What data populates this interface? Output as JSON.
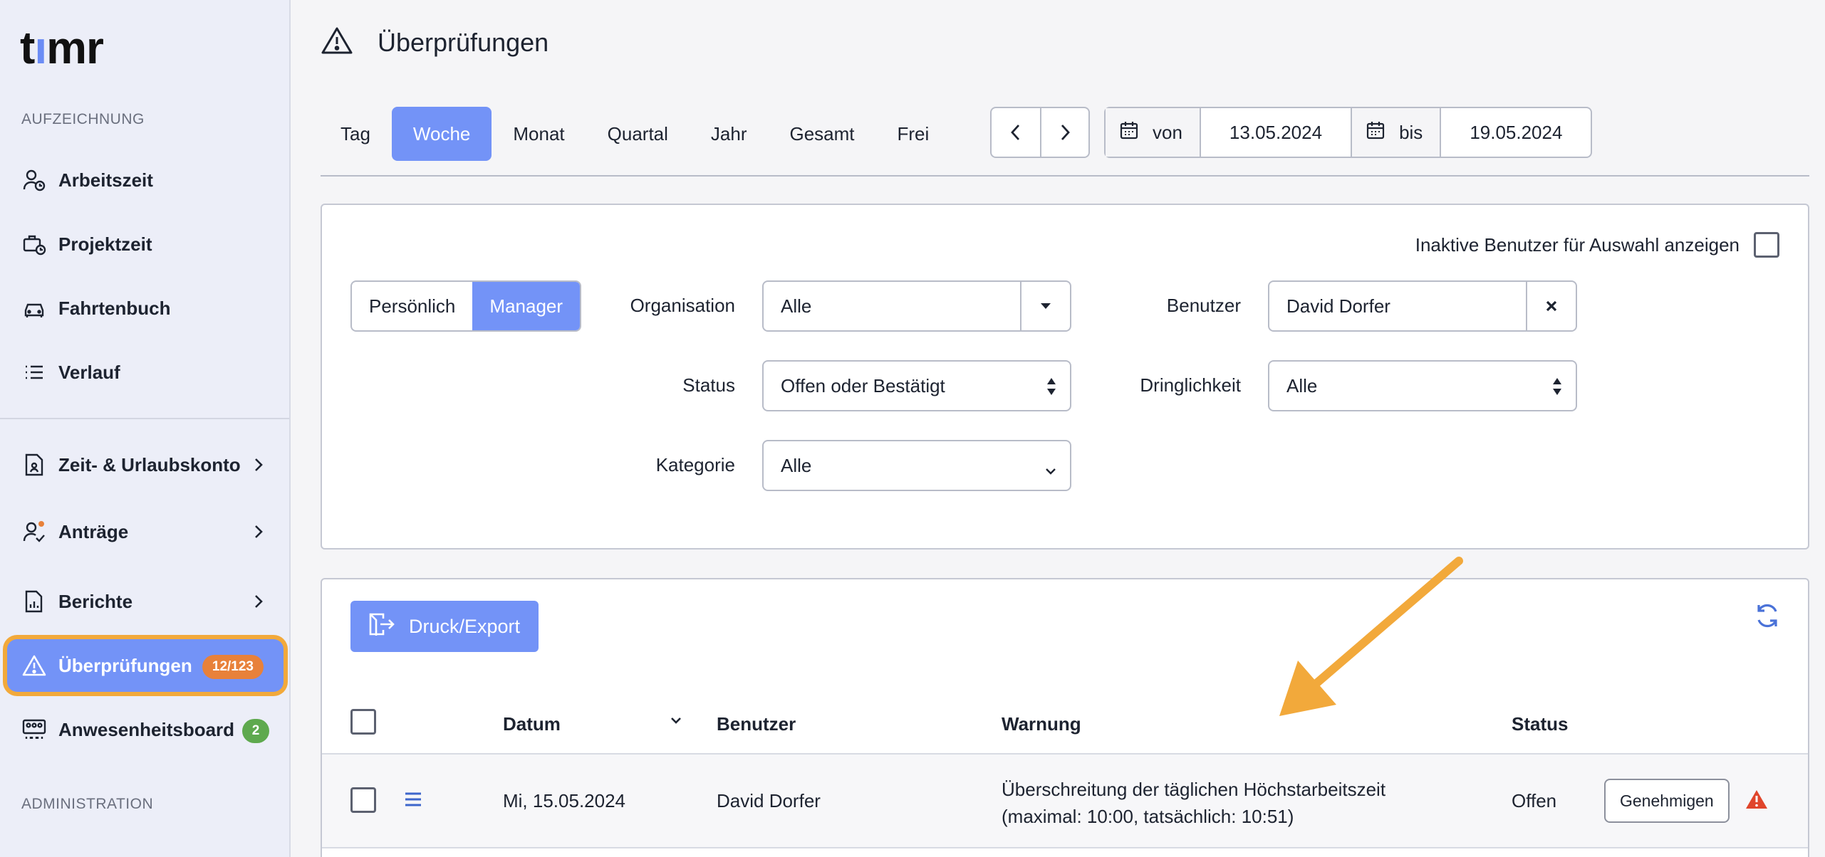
{
  "sidebar": {
    "logo": "timr",
    "section_recording": "AUFZEICHNUNG",
    "items": [
      {
        "label": "Arbeitszeit",
        "icon": "user-clock-icon"
      },
      {
        "label": "Projektzeit",
        "icon": "briefcase-clock-icon"
      },
      {
        "label": "Fahrtenbuch",
        "icon": "car-icon"
      },
      {
        "label": "Verlauf",
        "icon": "list-icon"
      },
      {
        "label": "Zeit- & Urlaubskonto",
        "icon": "account-document-icon"
      },
      {
        "label": "Anträge",
        "icon": "user-check-icon"
      },
      {
        "label": "Berichte",
        "icon": "report-icon"
      },
      {
        "label": "Überprüfungen",
        "icon": "warning-icon",
        "badge": "12/123"
      },
      {
        "label": "Anwesenheitsboard",
        "icon": "presence-board-icon",
        "badge": "2"
      }
    ],
    "section_admin": "ADMINISTRATION"
  },
  "header": {
    "title": "Überprüfungen",
    "icon": "warning-icon"
  },
  "range_tabs": [
    "Tag",
    "Woche",
    "Monat",
    "Quartal",
    "Jahr",
    "Gesamt",
    "Frei"
  ],
  "range_active": "Woche",
  "date_range": {
    "from_label": "von",
    "from": "13.05.2024",
    "to_label": "bis",
    "to": "19.05.2024"
  },
  "filters": {
    "inactive_label": "Inaktive Benutzer für Auswahl anzeigen",
    "mode_options": [
      "Persönlich",
      "Manager"
    ],
    "mode_active": "Manager",
    "organisation_label": "Organisation",
    "organisation_value": "Alle",
    "user_label": "Benutzer",
    "user_value": "David Dorfer",
    "status_label": "Status",
    "status_value": "Offen oder Bestätigt",
    "urgency_label": "Dringlichkeit",
    "urgency_value": "Alle",
    "category_label": "Kategorie",
    "category_value": "Alle"
  },
  "results": {
    "print_label": "Druck/Export",
    "columns": {
      "date": "Datum",
      "user": "Benutzer",
      "warning": "Warnung",
      "status": "Status"
    },
    "rows": [
      {
        "date": "Mi, 15.05.2024",
        "user": "David Dorfer",
        "warning_line1": "Überschreitung der täglichen Höchstarbeitszeit",
        "warning_line2": "(maximal: 10:00, tatsächlich: 10:51)",
        "status": "Offen",
        "action": "Genehmigen"
      }
    ]
  },
  "colors": {
    "accent": "#7393f7",
    "highlight": "#f2a93b",
    "badge_orange": "#e8813a",
    "badge_green": "#5ea94e",
    "alert": "#e0452b"
  }
}
